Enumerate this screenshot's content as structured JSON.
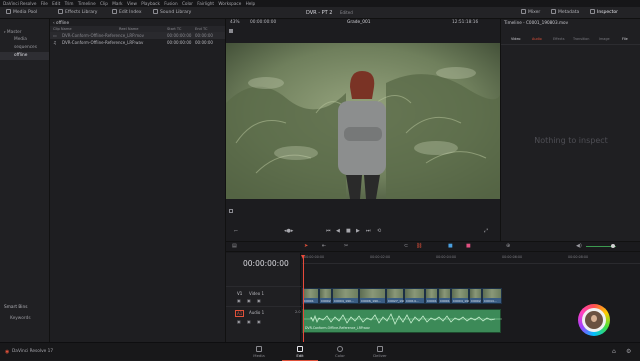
{
  "menu": [
    "DaVinci Resolve",
    "File",
    "Edit",
    "Trim",
    "Timeline",
    "Clip",
    "Mark",
    "View",
    "Playback",
    "Fusion",
    "Color",
    "Fairlight",
    "Workspace",
    "Help"
  ],
  "toolbar": {
    "media_pool": "Media Pool",
    "effects_library": "Effects Library",
    "edit_index": "Edit Index",
    "sound_library": "Sound Library",
    "project_title": "DVR - PT 2",
    "edited": "Edited",
    "mixer": "Mixer",
    "metadata": "Metadata",
    "inspector": "Inspector"
  },
  "bins": {
    "master": "Master",
    "items": [
      "Media",
      "sequences",
      "offline"
    ],
    "smart_bins": "Smart Bins",
    "smart_items": [
      "Keywords"
    ]
  },
  "pool": {
    "bin_name": "offline",
    "columns": [
      "Clip Name",
      "Reel Name",
      "Start TC",
      "End TC"
    ],
    "rows": [
      {
        "name": "DVR-Conform-Offline-Reference_LRP.mov",
        "reel": "",
        "start": "00:00:00:00",
        "end": "00:00:00"
      },
      {
        "name": "DVR-Conform-Offline-Reference_LRP.wav",
        "reel": "",
        "start": "00:00:00:00",
        "end": "00:00:00"
      }
    ]
  },
  "viewer": {
    "zoom": "43%",
    "timecode": "00:00:00:00",
    "clip_name": "Grade_001",
    "timecode_right": "12:51:18:16"
  },
  "inspector": {
    "title": "Timeline - C0001_190803.mov",
    "tabs": [
      "Video",
      "Audio",
      "Effects",
      "Transition",
      "Image",
      "File"
    ],
    "empty": "Nothing to inspect"
  },
  "timeline": {
    "timecode": "00:00:00:00",
    "ruler": [
      "00:00:00:00",
      "00:00:02:00",
      "00:00:04:00",
      "00:00:06:00",
      "00:00:08:00"
    ],
    "video_track": {
      "id": "V1",
      "name": "Video 1"
    },
    "audio_track": {
      "id": "A1",
      "name": "Audio 1",
      "level": "2.0"
    },
    "clips": [
      "C0001",
      "C0002",
      "C0004_190...",
      "C0006_190...",
      "C0027_190...",
      "C0014...",
      "C0001",
      "C0001",
      "C0004_190...",
      "C0002",
      "C0044..."
    ],
    "audio_clip": "DVR-Conform-Offline-Reference_LRP.wav"
  },
  "pages": [
    "Media",
    "Edit",
    "Color",
    "Deliver"
  ],
  "app_name": "DaVinci Resolve 17",
  "colors": {
    "accent": "#e0513a",
    "video_clip": "#3a5d84",
    "audio_clip": "#3c8a58",
    "playhead": "#e84a3a"
  }
}
